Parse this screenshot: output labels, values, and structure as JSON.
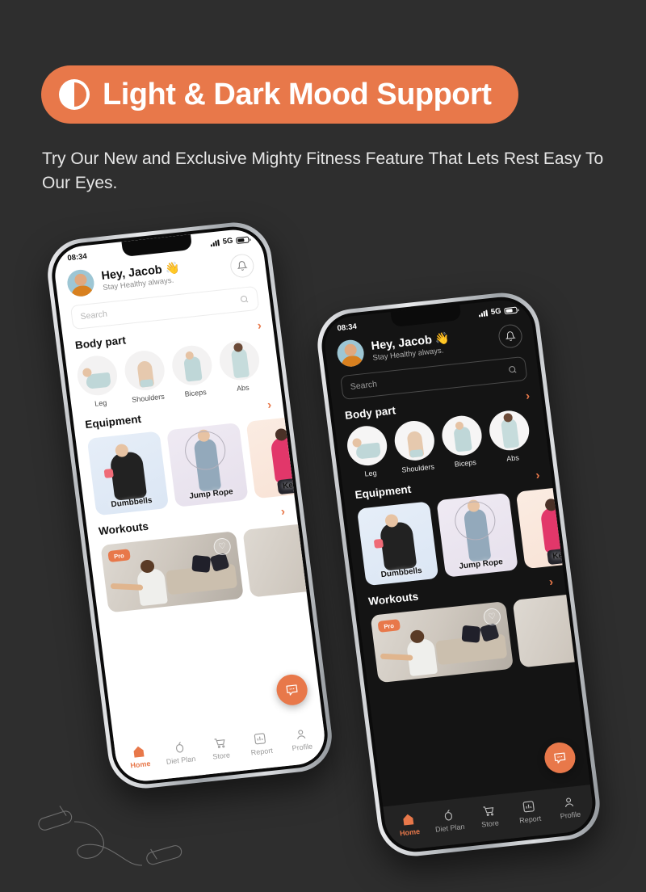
{
  "banner": {
    "icon": "contrast-half-circle-icon",
    "title": "Light & Dark Mood Support",
    "accent_color": "#e8784a"
  },
  "subtitle": "Try Our New and Exclusive Mighty Fitness Feature That Lets Rest Easy To Our Eyes.",
  "background_color": "#2e2e2e",
  "phones": [
    {
      "mode": "light",
      "screen_background": "#ffffff"
    },
    {
      "mode": "dark",
      "screen_background": "#141414"
    }
  ],
  "app": {
    "status_bar": {
      "time": "08:34",
      "network": "5G",
      "signal_icon": "signal-bars-icon",
      "battery_icon": "battery-icon"
    },
    "header": {
      "greeting": "Hey, Jacob 👋",
      "tagline": "Stay Healthy always.",
      "avatar": "user-avatar",
      "bell_icon": "bell-icon"
    },
    "search": {
      "placeholder": "Search",
      "value": "",
      "icon": "search-icon"
    },
    "sections": {
      "body_part": {
        "title": "Body part",
        "chevron": "›"
      },
      "equipment": {
        "title": "Equipment",
        "chevron": "›"
      },
      "workouts": {
        "title": "Workouts",
        "chevron": "›"
      }
    },
    "body_parts": [
      {
        "label": "Leg"
      },
      {
        "label": "Shoulders"
      },
      {
        "label": "Biceps"
      },
      {
        "label": "Abs"
      }
    ],
    "equipment": [
      {
        "label": "Dumbbells"
      },
      {
        "label": "Jump Rope"
      },
      {
        "label": "Kett"
      }
    ],
    "workout_card": {
      "badge": "Pro",
      "favorite_icon": "heart-icon"
    },
    "fab": {
      "icon": "chat-bubble-icon",
      "color": "#e8784a"
    },
    "bottom_nav": [
      {
        "label": "Home",
        "icon": "home-icon",
        "active": true
      },
      {
        "label": "Diet Plan",
        "icon": "apple-icon",
        "active": false
      },
      {
        "label": "Store",
        "icon": "cart-icon",
        "active": false
      },
      {
        "label": "Report",
        "icon": "chart-bars-icon",
        "active": false
      },
      {
        "label": "Profile",
        "icon": "person-icon",
        "active": false
      }
    ]
  },
  "decoration": {
    "jump_rope": "jump-rope-outline-icon"
  }
}
